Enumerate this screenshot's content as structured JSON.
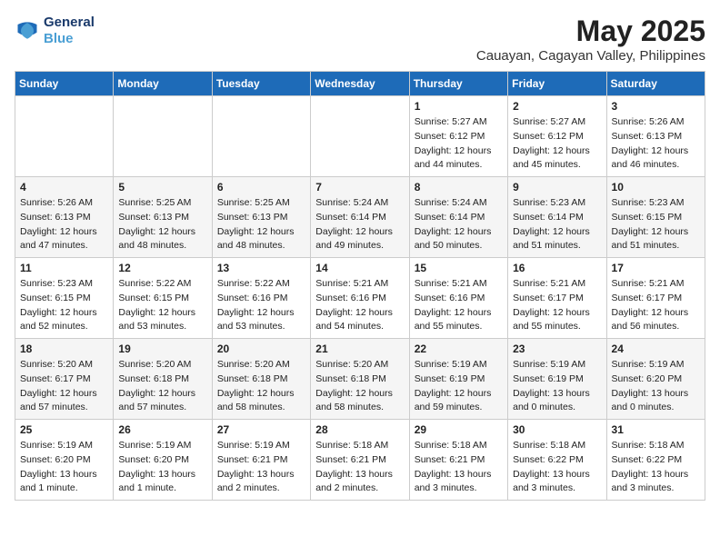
{
  "header": {
    "logo_line1": "General",
    "logo_line2": "Blue",
    "title": "May 2025",
    "subtitle": "Cauayan, Cagayan Valley, Philippines"
  },
  "weekdays": [
    "Sunday",
    "Monday",
    "Tuesday",
    "Wednesday",
    "Thursday",
    "Friday",
    "Saturday"
  ],
  "weeks": [
    [
      {
        "day": "",
        "info": ""
      },
      {
        "day": "",
        "info": ""
      },
      {
        "day": "",
        "info": ""
      },
      {
        "day": "",
        "info": ""
      },
      {
        "day": "1",
        "info": "Sunrise: 5:27 AM\nSunset: 6:12 PM\nDaylight: 12 hours\nand 44 minutes."
      },
      {
        "day": "2",
        "info": "Sunrise: 5:27 AM\nSunset: 6:12 PM\nDaylight: 12 hours\nand 45 minutes."
      },
      {
        "day": "3",
        "info": "Sunrise: 5:26 AM\nSunset: 6:13 PM\nDaylight: 12 hours\nand 46 minutes."
      }
    ],
    [
      {
        "day": "4",
        "info": "Sunrise: 5:26 AM\nSunset: 6:13 PM\nDaylight: 12 hours\nand 47 minutes."
      },
      {
        "day": "5",
        "info": "Sunrise: 5:25 AM\nSunset: 6:13 PM\nDaylight: 12 hours\nand 48 minutes."
      },
      {
        "day": "6",
        "info": "Sunrise: 5:25 AM\nSunset: 6:13 PM\nDaylight: 12 hours\nand 48 minutes."
      },
      {
        "day": "7",
        "info": "Sunrise: 5:24 AM\nSunset: 6:14 PM\nDaylight: 12 hours\nand 49 minutes."
      },
      {
        "day": "8",
        "info": "Sunrise: 5:24 AM\nSunset: 6:14 PM\nDaylight: 12 hours\nand 50 minutes."
      },
      {
        "day": "9",
        "info": "Sunrise: 5:23 AM\nSunset: 6:14 PM\nDaylight: 12 hours\nand 51 minutes."
      },
      {
        "day": "10",
        "info": "Sunrise: 5:23 AM\nSunset: 6:15 PM\nDaylight: 12 hours\nand 51 minutes."
      }
    ],
    [
      {
        "day": "11",
        "info": "Sunrise: 5:23 AM\nSunset: 6:15 PM\nDaylight: 12 hours\nand 52 minutes."
      },
      {
        "day": "12",
        "info": "Sunrise: 5:22 AM\nSunset: 6:15 PM\nDaylight: 12 hours\nand 53 minutes."
      },
      {
        "day": "13",
        "info": "Sunrise: 5:22 AM\nSunset: 6:16 PM\nDaylight: 12 hours\nand 53 minutes."
      },
      {
        "day": "14",
        "info": "Sunrise: 5:21 AM\nSunset: 6:16 PM\nDaylight: 12 hours\nand 54 minutes."
      },
      {
        "day": "15",
        "info": "Sunrise: 5:21 AM\nSunset: 6:16 PM\nDaylight: 12 hours\nand 55 minutes."
      },
      {
        "day": "16",
        "info": "Sunrise: 5:21 AM\nSunset: 6:17 PM\nDaylight: 12 hours\nand 55 minutes."
      },
      {
        "day": "17",
        "info": "Sunrise: 5:21 AM\nSunset: 6:17 PM\nDaylight: 12 hours\nand 56 minutes."
      }
    ],
    [
      {
        "day": "18",
        "info": "Sunrise: 5:20 AM\nSunset: 6:17 PM\nDaylight: 12 hours\nand 57 minutes."
      },
      {
        "day": "19",
        "info": "Sunrise: 5:20 AM\nSunset: 6:18 PM\nDaylight: 12 hours\nand 57 minutes."
      },
      {
        "day": "20",
        "info": "Sunrise: 5:20 AM\nSunset: 6:18 PM\nDaylight: 12 hours\nand 58 minutes."
      },
      {
        "day": "21",
        "info": "Sunrise: 5:20 AM\nSunset: 6:18 PM\nDaylight: 12 hours\nand 58 minutes."
      },
      {
        "day": "22",
        "info": "Sunrise: 5:19 AM\nSunset: 6:19 PM\nDaylight: 12 hours\nand 59 minutes."
      },
      {
        "day": "23",
        "info": "Sunrise: 5:19 AM\nSunset: 6:19 PM\nDaylight: 13 hours\nand 0 minutes."
      },
      {
        "day": "24",
        "info": "Sunrise: 5:19 AM\nSunset: 6:20 PM\nDaylight: 13 hours\nand 0 minutes."
      }
    ],
    [
      {
        "day": "25",
        "info": "Sunrise: 5:19 AM\nSunset: 6:20 PM\nDaylight: 13 hours\nand 1 minute."
      },
      {
        "day": "26",
        "info": "Sunrise: 5:19 AM\nSunset: 6:20 PM\nDaylight: 13 hours\nand 1 minute."
      },
      {
        "day": "27",
        "info": "Sunrise: 5:19 AM\nSunset: 6:21 PM\nDaylight: 13 hours\nand 2 minutes."
      },
      {
        "day": "28",
        "info": "Sunrise: 5:18 AM\nSunset: 6:21 PM\nDaylight: 13 hours\nand 2 minutes."
      },
      {
        "day": "29",
        "info": "Sunrise: 5:18 AM\nSunset: 6:21 PM\nDaylight: 13 hours\nand 3 minutes."
      },
      {
        "day": "30",
        "info": "Sunrise: 5:18 AM\nSunset: 6:22 PM\nDaylight: 13 hours\nand 3 minutes."
      },
      {
        "day": "31",
        "info": "Sunrise: 5:18 AM\nSunset: 6:22 PM\nDaylight: 13 hours\nand 3 minutes."
      }
    ]
  ]
}
